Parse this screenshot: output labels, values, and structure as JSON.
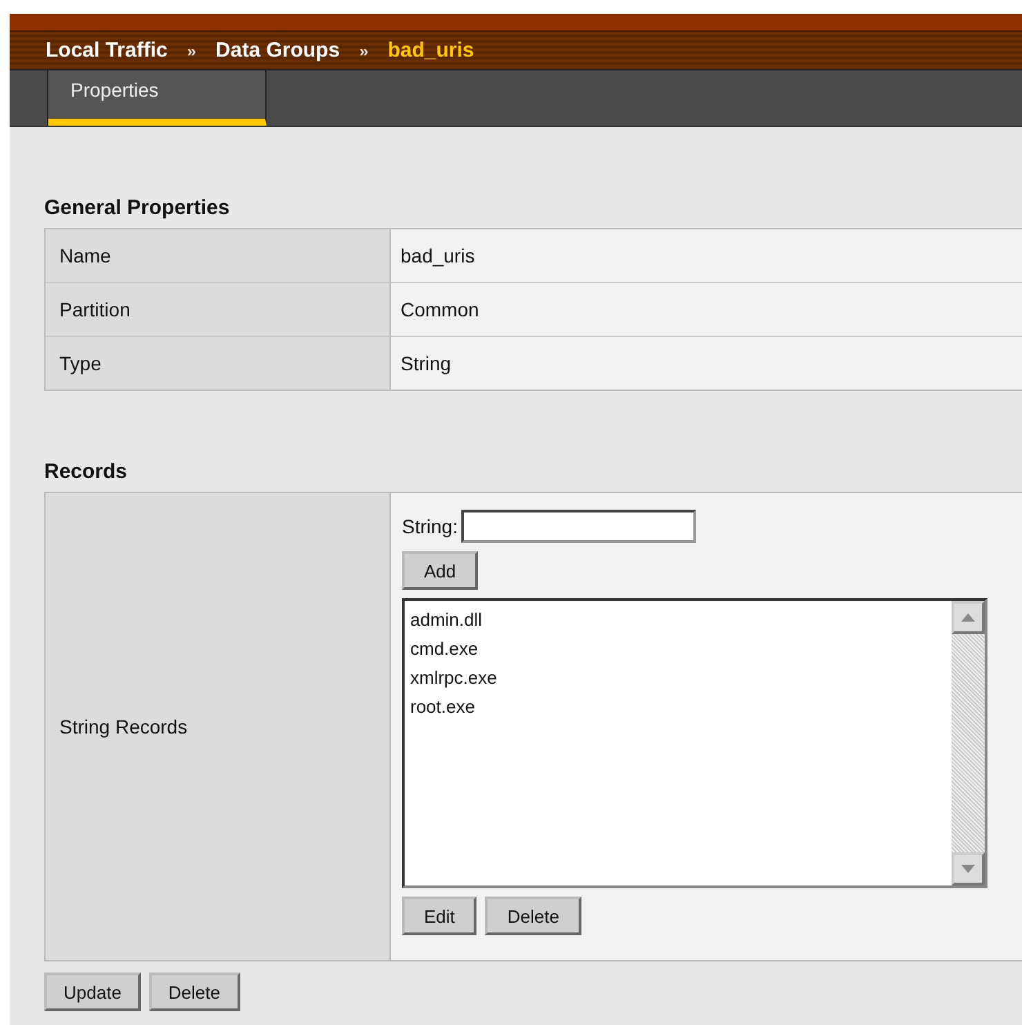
{
  "breadcrumb": [
    {
      "label": "Local Traffic",
      "current": false
    },
    {
      "label": "»",
      "kind": "separator"
    },
    {
      "label": "Data Groups",
      "current": false
    },
    {
      "label": "»",
      "kind": "separator"
    },
    {
      "label": "bad_uris",
      "current": true
    }
  ],
  "tabs": [
    {
      "label": "Properties",
      "selected": true
    }
  ],
  "general": {
    "title": "General Properties",
    "rows": [
      {
        "label": "Name",
        "value": "bad_uris"
      },
      {
        "label": "Partition",
        "value": "Common"
      },
      {
        "label": "Type",
        "value": "String"
      }
    ]
  },
  "records": {
    "title": "Records",
    "label": "String Records",
    "string_label": "String:",
    "add_button": "Add",
    "items": [
      "admin.dll",
      "cmd.exe",
      "xmlrpc.exe",
      "root.exe"
    ],
    "edit_button": "Edit",
    "delete_button": "Delete"
  },
  "buttons": [
    "Update",
    "Delete"
  ]
}
